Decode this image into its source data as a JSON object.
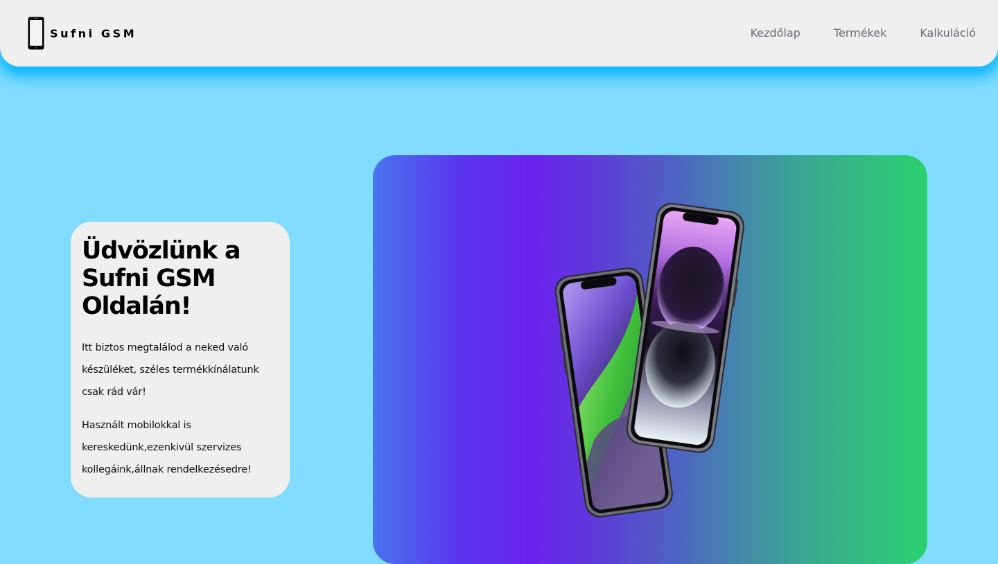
{
  "header": {
    "logo_icon": "phone-icon",
    "brand": "Sufni GSM",
    "nav": [
      {
        "label": "Kezdőlap"
      },
      {
        "label": "Termékek"
      },
      {
        "label": "Kalkuláció"
      }
    ]
  },
  "welcome": {
    "title": "Üdvözlünk a Sufni GSM Oldalán!",
    "paragraph1": "Itt biztos megtalálod a neked való készüléket, széles termékkínálatunk csak rád vár!",
    "paragraph2": "Használt mobilokkal is kereskedünk,ezenkivül szervizes kollegáink,állnak rendelkezésedre!"
  },
  "hero": {
    "image": "two-smartphones-illustration"
  },
  "colors": {
    "page_background": "#82dcff",
    "header_background": "#efefef",
    "header_glow": "#00b3ff",
    "card_background": "#efefef",
    "gradient_start": "#4a74ef",
    "gradient_mid": "#6b21ee",
    "gradient_end": "#2bd06f"
  }
}
